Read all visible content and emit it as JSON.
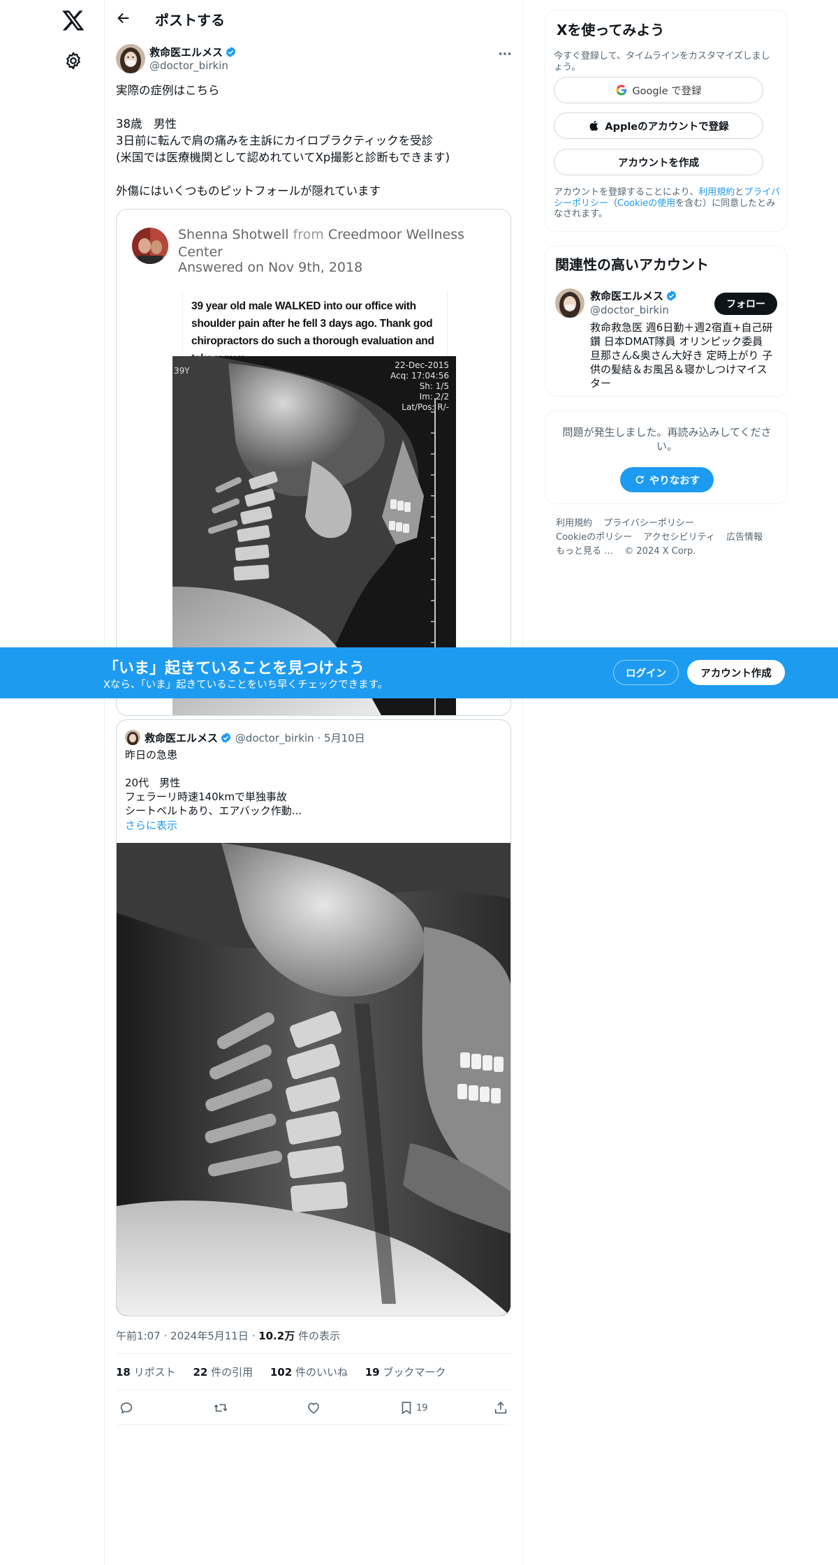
{
  "topbar": {
    "title": "ポストする"
  },
  "tweet": {
    "author_name": "救命医エルメス",
    "author_handle": "@doctor_birkin",
    "text": "実際の症例はこちら\n\n38歳　男性\n3日前に転んで肩の痛みを主訴にカイロプラクティックを受診\n(米国では医療機関として認めれていてXp撮影と診断もできます)\n\n外傷にはいくつものピットフォールが隠れています"
  },
  "answer_card": {
    "name": "Shenna Shotwell",
    "from_word": "from",
    "org": "Creedmoor Wellness Center",
    "date": "Answered on Nov 9th, 2018",
    "image_caption": "39 year old male WALKED into our office with shoulder pain after he fell 3 days ago. Thank god chiropractors do such a thorough evaluation and take x-rays.",
    "xray_meta": "22-Dec-2015\nAcq: 17:04:56\nSh: 1/5\nIm: 2/2\nLat/Pos: R/-",
    "xray_left_label": "39Y"
  },
  "quoted_tweet": {
    "name": "救命医エルメス",
    "handle": "@doctor_birkin",
    "dot": "·",
    "date": "5月10日",
    "text": "昨日の急患\n\n20代　男性\nフェラーリ時速140kmで単独事故\nシートベルトあり、エアバック作動...",
    "show_more": "さらに表示"
  },
  "meta": {
    "time": "午前1:07",
    "dot": "·",
    "date": "2024年5月11日",
    "views_count": "10.2万",
    "views_label": " 件の表示"
  },
  "stats": {
    "retweets": "18",
    "retweets_label": " リポスト",
    "quotes": "22",
    "quotes_label": " 件の引用",
    "likes": "102",
    "likes_label": " 件のいいね",
    "bookmarks": "19",
    "bookmarks_label": " ブックマーク"
  },
  "actions": {
    "bookmark_count": "19"
  },
  "signup_panel": {
    "title": "Xを使ってみよう",
    "subtitle": "今すぐ登録して、タイムラインをカスタマイズしましょう。",
    "google_label": "Google で登録",
    "apple_label": "Appleのアカウントで登録",
    "create_label": "アカウントを作成",
    "terms_prefix": "アカウントを登録することにより、",
    "terms_link1": "利用規約",
    "terms_and": "と",
    "terms_link2": "プライバシーポリシー",
    "terms_paren_open": "（",
    "terms_link3": "Cookieの使用",
    "terms_suffix": "を含む）に同意したとみなされます。"
  },
  "related_panel": {
    "title": "関連性の高いアカウント",
    "name": "救命医エルメス",
    "handle": "@doctor_birkin",
    "follow_label": "フォロー",
    "bio": "救命救急医 週6日勤＋週2宿直+自己研鑽 日本DMAT隊員 オリンピック委員 旦那さん&奥さん大好き 定時上がり 子供の髪結＆お風呂＆寝かしつけマイスター"
  },
  "error_panel": {
    "text": "問題が発生しました。再読み込みしてください。",
    "retry_label": "やりなおす"
  },
  "footer": {
    "links": [
      "利用規約",
      "プライバシーポリシー",
      "Cookieのポリシー",
      "アクセシビリティ",
      "広告情報",
      "もっと見る …",
      "© 2024 X Corp."
    ]
  },
  "banner": {
    "title": "「いま」起きていることを見つけよう",
    "subtitle": "Xなら、「いま」起きていることをいち早くチェックできます。",
    "login_label": "ログイン",
    "signup_label": "アカウント作成"
  },
  "colors": {
    "accent": "#1d9bf0",
    "text": "#0f1419",
    "muted": "#536471",
    "border": "#eff3f4"
  }
}
